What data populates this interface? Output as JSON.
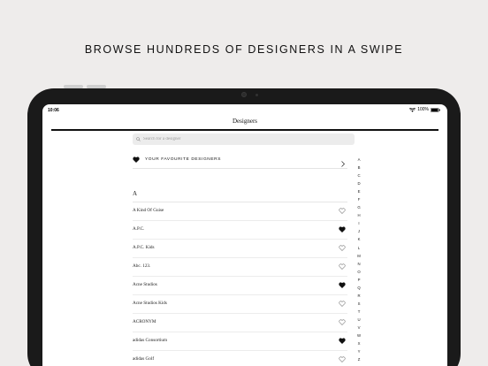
{
  "headline": "BROWSE HUNDREDS OF DESIGNERS IN A SWIPE",
  "status_bar": {
    "time": "10:06",
    "battery": "100%"
  },
  "navbar": {
    "title": "Designers"
  },
  "search": {
    "placeholder": "Search for a designer"
  },
  "favourites": {
    "label": "YOUR FAVOURITE DESIGNERS"
  },
  "section": {
    "letter": "A"
  },
  "designers": [
    {
      "name": "A Kind Of Guise",
      "favourite": false
    },
    {
      "name": "A.P.C.",
      "favourite": true
    },
    {
      "name": "A.P.C. Kids",
      "favourite": false
    },
    {
      "name": "Abc. 123.",
      "favourite": false
    },
    {
      "name": "Acne Studios",
      "favourite": true
    },
    {
      "name": "Acne Studios Kids",
      "favourite": false
    },
    {
      "name": "ACRONYM",
      "favourite": false
    },
    {
      "name": "adidas Consortium",
      "favourite": true
    },
    {
      "name": "adidas Golf",
      "favourite": false
    }
  ],
  "alphabet": [
    "A",
    "B",
    "C",
    "D",
    "E",
    "F",
    "G",
    "H",
    "I",
    "J",
    "K",
    "L",
    "M",
    "N",
    "O",
    "P",
    "Q",
    "R",
    "S",
    "T",
    "U",
    "V",
    "W",
    "X",
    "Y",
    "Z",
    "#"
  ],
  "icons": {
    "favourite_filled": "heart-filled-icon",
    "favourite_empty": "heart-outline-icon",
    "search": "search-icon",
    "chevron": "chevron-right-icon"
  }
}
